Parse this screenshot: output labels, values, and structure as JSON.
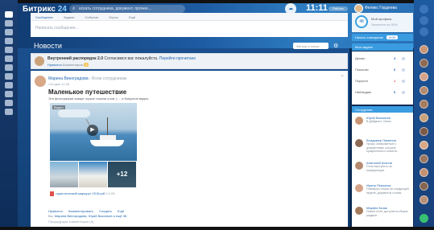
{
  "app": {
    "name": "Битрикс",
    "version": "24"
  },
  "header": {
    "search_placeholder": "искать сотрудника, документ, прочее...",
    "clock": "11:11",
    "status": "Работа",
    "user_name": "Феликс Гордеева"
  },
  "composer": {
    "tabs": [
      "Сообщение",
      "Задачи",
      "События",
      "Опрос",
      "Ещё"
    ],
    "input_placeholder": "Написать сообщение..."
  },
  "feed": {
    "title": "Новости",
    "search_placeholder": "Фильтр и поиск"
  },
  "pinned": {
    "author": "Внутренний распорядок 2.0",
    "text": "Согласимся вас пожалуйста.",
    "link": "Перейти прочитано",
    "meta_like": "Нравится",
    "meta_comments": "Комментарии",
    "badge": "4"
  },
  "post": {
    "author": "Марина Виноградова",
    "to": "Всем сотрудникам",
    "date": "Сегодня 11:08",
    "title": "Маленькое путешествие",
    "body": "Эти фотографии скажут лучше тысячи слов :) ... и бонусное видео.",
    "photo_badge": "Видео",
    "more_count": "+12",
    "file_name": "туристический маршрут 2018.pdf",
    "file_size": "3.5 КБ",
    "actions": [
      "Нравится",
      "Комментировать",
      "Следить",
      "Ещё"
    ],
    "likers_prefix": "Вы,",
    "likers": "Марина Виноградова, Юрий Васильев и ещё 38",
    "comments_more": "Предыдущие комментарии (8)"
  },
  "sidebar": {
    "profile_count": "48",
    "profile_line1": "Мой профиль",
    "profile_line2": "Заполнен на 90%",
    "bar1_label": "Начать совещание",
    "bar1_pill": "0:00",
    "tasks_title": "Мои задачи",
    "tasks": [
      {
        "label": "Делаю",
        "count": "4"
      },
      {
        "label": "Помогаю",
        "count": "0"
      },
      {
        "label": "Поручил",
        "count": "1"
      },
      {
        "label": "Наблюдаю",
        "count": "0"
      }
    ],
    "emps_title": "Сотрудники",
    "employees": [
      {
        "name": "Юрий Васильев",
        "text": "В Дайджест, Связи",
        "color": "#c99574"
      },
      {
        "name": "Владимир Пименов",
        "text": "Прошу ознакомиться с документами, которые прикреплены к новости.",
        "color": "#8c6a55"
      },
      {
        "name": "Анатолий Козлов",
        "text": "Готов выступить на конференции.",
        "color": "#b58a70"
      },
      {
        "name": "Ирина Першина",
        "text": "Планирую отпуск на следующей неделе, документы готовы.",
        "color": "#d4a38a"
      },
      {
        "name": "Марина Козак",
        "text": "Новый отчёт доступен в общем разделе.",
        "color": "#a57b5e"
      }
    ]
  },
  "colors": {
    "accent": "#2067b0",
    "header_bg": "#1d5aa0",
    "sidebar_bar": "#3a9be0",
    "alert_red": "#e0504a",
    "call_green": "#38c172"
  }
}
